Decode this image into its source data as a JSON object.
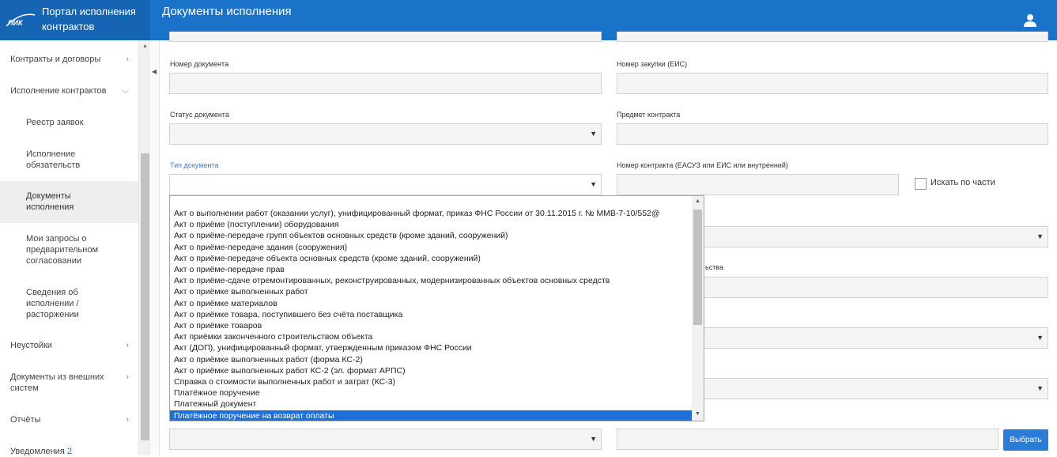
{
  "header": {
    "brand_line1": "Портал исполнения",
    "brand_line2": "контрактов",
    "logo_text": "ПИК",
    "page_title": "Документы исполнения",
    "user_icon": "user-icon"
  },
  "sidebar": {
    "items": [
      {
        "label": "Контракты и договоры"
      },
      {
        "label": "Исполнение контрактов"
      },
      {
        "label": "Реестр заявок"
      },
      {
        "label1": "Исполнение",
        "label2": "обязательств"
      },
      {
        "label1": "Документы",
        "label2": "исполнения"
      },
      {
        "label1": "Мои запросы о",
        "label2": "предварительном",
        "label3": "согласовании"
      },
      {
        "label1": "Сведения об",
        "label2": "исполнении /",
        "label3": "расторжении"
      },
      {
        "label": "Неустойки"
      },
      {
        "label1": "Документы из внешних",
        "label2": "систем"
      },
      {
        "label": "Отчёты"
      },
      {
        "label": "Уведомления",
        "badge": "2"
      }
    ]
  },
  "form": {
    "doc_number_label": "Номер документа",
    "purchase_number_label": "Номер закупки (ЕИС)",
    "doc_status_label": "Статус документа",
    "contract_subject_label": "Предмет контракта",
    "doc_type_label": "Тип документа",
    "contract_number_label": "Номер контракта (ЕАСУЗ или ЕИС или внутренний)",
    "partial_search_label": "Искать по части",
    "partial_label_fragment": "ьства",
    "select_button": "Выбрать"
  },
  "doc_type_options": [
    "Акт о выполнении работ (оказании услуг), унифицированный формат, приказ ФНС России от 30.11.2015 г. № ММВ-7-10/552@",
    "Акт о приёме (поступлении) оборудования",
    "Акт о приёме-передаче групп объектов основных средств (кроме зданий, сооружений)",
    "Акт о приёме-передаче здания (сооружения)",
    "Акт о приёме-передаче объекта основных средств (кроме зданий, сооружений)",
    "Акт о приёме-передаче прав",
    "Акт о приёме-сдаче отремонтированных, реконструированных, модернизированных объектов основных средств",
    "Акт о приёмке выполненных работ",
    "Акт о приёмке материалов",
    "Акт о приёмке товара, поступившего без счёта поставщика",
    "Акт о приёмке товаров",
    "Акт приёмки законченного строительством объекта",
    "Акт (ДОП), унифицированный формат, утвержденным приказом ФНС России",
    "Акт о приёмке выполненных работ (форма КС-2)",
    "Акт о приёмке выполненных работ КС-2 (эл. формат АРПС)",
    "Справка о стоимости выполненных работ и затрат (КС-3)",
    "Платёжное поручение",
    "Платежный документ",
    "Платёжное поручение на возврат оплаты"
  ],
  "selected_option_index": 18
}
